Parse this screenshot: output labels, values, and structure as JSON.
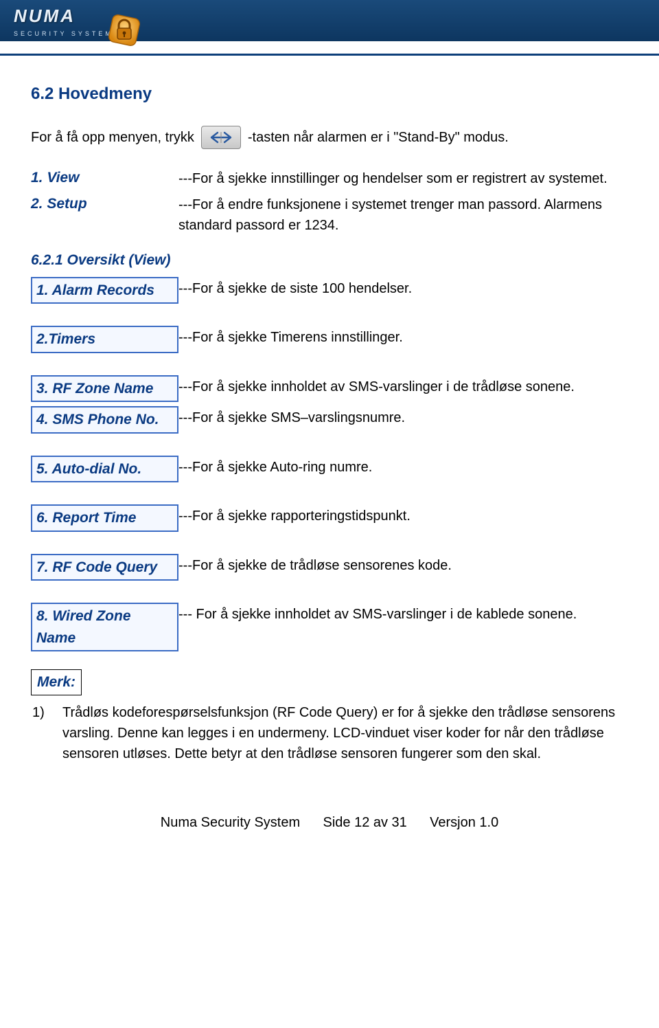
{
  "brand": {
    "name": "NUMA",
    "sub": "SECURITY SYSTEM"
  },
  "heading": "6.2 Hovedmeny",
  "intro": {
    "pre": "For å få opp menyen, trykk",
    "post": "-tasten når alarmen er i \"Stand-By\" modus."
  },
  "menu_top": [
    {
      "label": "1.  View",
      "desc": "---For å sjekke innstillinger og hendelser som er registrert av systemet."
    },
    {
      "label": "2.  Setup",
      "desc": "---For å endre funksjonene i systemet trenger man passord. Alarmens standard passord er 1234."
    }
  ],
  "subsection": "6.2.1 Oversikt (View)",
  "view_items": [
    {
      "label": "1. Alarm Records",
      "desc": "---For å sjekke de siste 100 hendelser."
    },
    {
      "label": "2.Timers",
      "desc": "---For å sjekke Timerens innstillinger."
    },
    {
      "label": "3. RF Zone Name",
      "desc": "---For å sjekke innholdet av SMS-varslinger i de trådløse sonene."
    },
    {
      "label": "4. SMS Phone No.",
      "desc": "---For å sjekke SMS–varslingsnumre."
    },
    {
      "label": "5. Auto-dial No.",
      "desc": "---For å sjekke Auto-ring numre."
    },
    {
      "label": "6. Report Time",
      "desc": "---For å sjekke rapporteringstidspunkt."
    },
    {
      "label": "7. RF Code Query",
      "desc": "---For å sjekke de trådløse sensorenes kode."
    },
    {
      "label": "8. Wired Zone Name",
      "desc": "--- For å sjekke innholdet av SMS-varslinger i de kablede sonene."
    }
  ],
  "merk_label": "Merk:",
  "merk_notes": [
    {
      "num": "1)",
      "text": "Trådløs kodeforespørselsfunksjon (RF Code Query) er for å sjekke den trådløse sensorens varsling. Denne kan legges i en undermeny. LCD-vinduet viser koder for når den trådløse sensoren utløses. Dette betyr at den trådløse sensoren fungerer som den skal."
    }
  ],
  "footer": {
    "left": "Numa Security System",
    "mid": "Side 12 av 31",
    "right": "Versjon 1.0"
  }
}
